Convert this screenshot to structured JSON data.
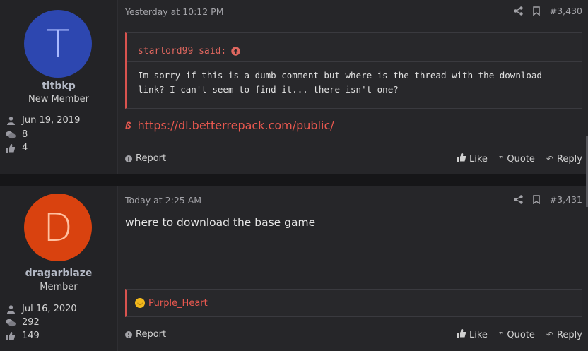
{
  "posts": [
    {
      "avatar_letter": "T",
      "username": "tltbkp",
      "user_title": "New Member",
      "joined": "Jun 19, 2019",
      "messages": "8",
      "reactions": "4",
      "date": "Yesterday at 10:12 PM",
      "post_number": "#3,430",
      "quote_author": "starlord99 said:",
      "quote_text": "Im sorry if this is a dumb comment but where is the thread with the download link? I can't seem to find it... there isn't one?",
      "link": "https://dl.betterrepack.com/public/",
      "report_label": "Report",
      "like_label": "Like",
      "quote_label": "Quote",
      "reply_label": "Reply"
    },
    {
      "avatar_letter": "D",
      "avatar_color": "#d9420f",
      "username": "dragarblaze",
      "user_title": "Member",
      "joined": "Jul 16, 2020",
      "messages": "292",
      "reactions": "149",
      "date": "Today at 2:25 AM",
      "post_number": "#3,431",
      "body": "where to download the base game",
      "reaction_user": "Purple_Heart",
      "report_label": "Report",
      "like_label": "Like",
      "quote_label": "Quote",
      "reply_label": "Reply"
    }
  ],
  "colors": {
    "accent": "#e8584f",
    "avatar1": "#2d47b0",
    "avatar2": "#d9420f"
  }
}
